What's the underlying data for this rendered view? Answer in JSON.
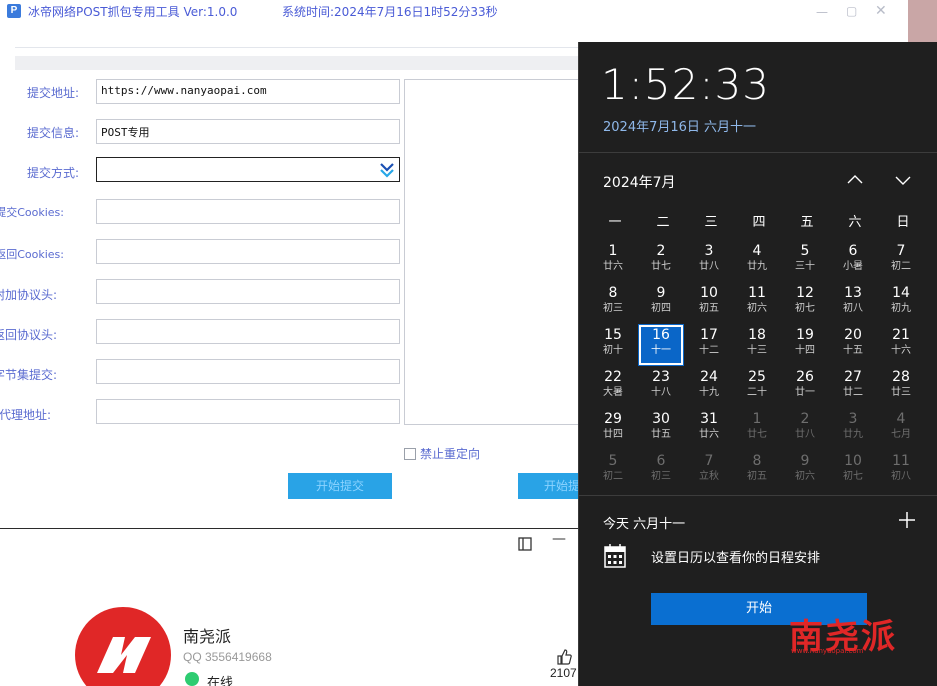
{
  "tool": {
    "title": "冰帝网络POST抓包专用工具 Ver:1.0.0",
    "system_time": "系统时间:2024年7月16日1时52分33秒",
    "icon_letter": "P",
    "fields": [
      {
        "label": "提交地址:",
        "value": "https://www.nanyaopai.com"
      },
      {
        "label": "提交信息:",
        "value": "POST专用"
      },
      {
        "label": "提交方式:",
        "value": ""
      },
      {
        "label": "提交Cookies:",
        "value": ""
      },
      {
        "label": "返回Cookies:",
        "value": ""
      },
      {
        "label": "附加协议头:",
        "value": ""
      },
      {
        "label": "返回协议头:",
        "value": ""
      },
      {
        "label": "字节集提交:",
        "value": ""
      },
      {
        "label": "代理地址:",
        "value": ""
      }
    ],
    "checkbox_label": "禁止重定向",
    "submit_button": "开始提交",
    "second_button": "开始提"
  },
  "profile": {
    "name": "南尧派",
    "qq": "QQ 3556419668",
    "status": "在线",
    "likes": "2107"
  },
  "calendar": {
    "time": "1:52:33",
    "date": "2024年7月16日 六月十一",
    "month": "2024年7月",
    "weekdays": [
      "一",
      "二",
      "三",
      "四",
      "五",
      "六",
      "日"
    ],
    "days": [
      {
        "n": "1",
        "l": "廿六"
      },
      {
        "n": "2",
        "l": "廿七"
      },
      {
        "n": "3",
        "l": "廿八"
      },
      {
        "n": "4",
        "l": "廿九"
      },
      {
        "n": "5",
        "l": "三十"
      },
      {
        "n": "6",
        "l": "小暑"
      },
      {
        "n": "7",
        "l": "初二"
      },
      {
        "n": "8",
        "l": "初三"
      },
      {
        "n": "9",
        "l": "初四"
      },
      {
        "n": "10",
        "l": "初五"
      },
      {
        "n": "11",
        "l": "初六"
      },
      {
        "n": "12",
        "l": "初七"
      },
      {
        "n": "13",
        "l": "初八"
      },
      {
        "n": "14",
        "l": "初九"
      },
      {
        "n": "15",
        "l": "初十"
      },
      {
        "n": "16",
        "l": "十一"
      },
      {
        "n": "17",
        "l": "十二"
      },
      {
        "n": "18",
        "l": "十三"
      },
      {
        "n": "19",
        "l": "十四"
      },
      {
        "n": "20",
        "l": "十五"
      },
      {
        "n": "21",
        "l": "十六"
      },
      {
        "n": "22",
        "l": "大暑"
      },
      {
        "n": "23",
        "l": "十八"
      },
      {
        "n": "24",
        "l": "十九"
      },
      {
        "n": "25",
        "l": "二十"
      },
      {
        "n": "26",
        "l": "廿一"
      },
      {
        "n": "27",
        "l": "廿二"
      },
      {
        "n": "28",
        "l": "廿三"
      },
      {
        "n": "29",
        "l": "廿四"
      },
      {
        "n": "30",
        "l": "廿五"
      },
      {
        "n": "31",
        "l": "廿六"
      },
      {
        "n": "1",
        "l": "廿七"
      },
      {
        "n": "2",
        "l": "廿八"
      },
      {
        "n": "3",
        "l": "廿九"
      },
      {
        "n": "4",
        "l": "七月"
      },
      {
        "n": "5",
        "l": "初二"
      },
      {
        "n": "6",
        "l": "初三"
      },
      {
        "n": "7",
        "l": "立秋"
      },
      {
        "n": "8",
        "l": "初五"
      },
      {
        "n": "9",
        "l": "初六"
      },
      {
        "n": "10",
        "l": "初七"
      },
      {
        "n": "11",
        "l": "初八"
      }
    ],
    "today_index": 15,
    "first_dim_index": 31,
    "today_label": "今天 六月十一",
    "schedule_msg": "设置日历以查看你的日程安排",
    "start_button": "开始",
    "accent_color": "#0a66c8"
  },
  "watermark": {
    "text": "南尧派",
    "url": "www.nanyaopai.com"
  }
}
